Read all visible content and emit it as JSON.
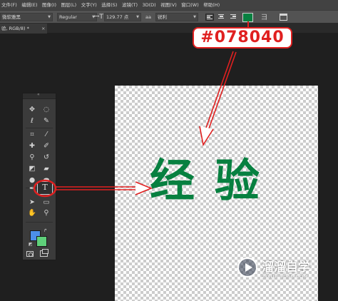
{
  "menubar": {
    "items": [
      "文件(F)",
      "编辑(E)",
      "图像(I)",
      "图层(L)",
      "文字(Y)",
      "选择(S)",
      "滤镜(T)",
      "3D(D)",
      "视图(V)",
      "窗口(W)",
      "帮助(H)"
    ]
  },
  "options": {
    "font_family": "微软雅黑",
    "font_style": "Regular",
    "font_size": "129.77 点",
    "antialias_label": "aa",
    "antialias": "锐利",
    "text_color": "#078040"
  },
  "document": {
    "tab_label": "验, RGB/8) *",
    "tab_close": "×"
  },
  "tools": {
    "icons": [
      "move-icon",
      "marquee-icon",
      "lasso-icon",
      "quick-select-icon",
      "crop-icon",
      "eyedropper-icon",
      "healing-brush-icon",
      "brush-icon",
      "clone-stamp-icon",
      "history-brush-icon",
      "eraser-icon",
      "gradient-icon",
      "blur-icon",
      "dodge-icon",
      "pen-icon",
      "type-icon",
      "path-select-icon",
      "rectangle-shape-icon",
      "hand-icon",
      "zoom-icon"
    ],
    "type_tool_glyph": "T",
    "foreground_color": "#4c8fe8",
    "background_color": "#5fd07a"
  },
  "canvas": {
    "text": "经验",
    "text_color": "#078040"
  },
  "annotation": {
    "color_label": "#078040",
    "color": "#e02020"
  },
  "watermark": {
    "title": "溜溜自学",
    "url": "ZIXUE.3D66.COM"
  }
}
